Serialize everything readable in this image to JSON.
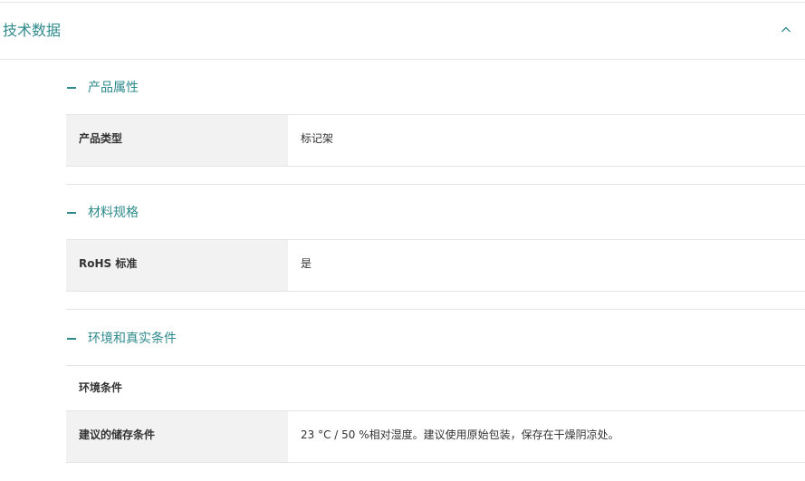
{
  "main": {
    "title": "技术数据"
  },
  "sections": [
    {
      "title": "产品属性",
      "rows": [
        {
          "label": "产品类型",
          "value": "标记架"
        }
      ]
    },
    {
      "title": "材料规格",
      "rows": [
        {
          "label": "RoHS 标准",
          "value": "是"
        }
      ]
    },
    {
      "title": "环境和真实条件",
      "rows": [
        {
          "label": "环境条件",
          "value": ""
        },
        {
          "label": "建议的储存条件",
          "value": "23 °C / 50 %相对湿度。建议使用原始包装，保存在干燥阴凉处。"
        }
      ]
    }
  ],
  "colors": {
    "accent": "#2f8a8c",
    "label_bg": "#f2f2f2",
    "divider": "#e4e4e4"
  },
  "icons": {
    "collapse": "chevron-up-icon",
    "section_toggle": "minus-icon"
  }
}
